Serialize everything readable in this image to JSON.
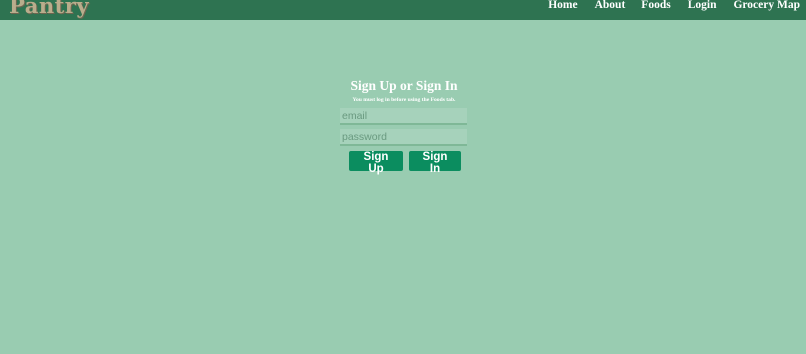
{
  "navbar": {
    "brand": "Pantry",
    "links": {
      "home": "Home",
      "about": "About",
      "foods": "Foods",
      "login": "Login",
      "grocery_map": "Grocery Map"
    }
  },
  "auth": {
    "title": "Sign Up or Sign In",
    "note": "You must log in before using the Foods tab.",
    "email_placeholder": "email",
    "password_placeholder": "password",
    "signup_label": "Sign Up",
    "signin_label": "Sign In"
  },
  "colors": {
    "page_background": "#99ccb1",
    "navbar": "#2e7351",
    "button": "#0b8d5f"
  }
}
